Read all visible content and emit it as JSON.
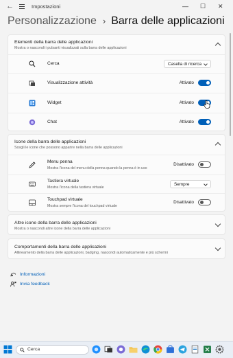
{
  "window": {
    "title": "Impostazioni",
    "back_glyph": "←",
    "min_glyph": "—",
    "max_glyph": "☐",
    "close_glyph": "✕"
  },
  "breadcrumb": {
    "parent": "Personalizzazione",
    "separator": "›",
    "current": "Barra delle applicazioni"
  },
  "section_taskbar_items": {
    "title": "Elementi della barra delle applicazioni",
    "subtitle": "Mostra o nascondi i pulsanti visualizzati sulla barra delle applicazioni",
    "items": [
      {
        "label": "Cerca",
        "control": "dropdown",
        "value": "Casella di ricerca",
        "icon": "search-icon"
      },
      {
        "label": "Visualizzazione attività",
        "control": "toggle",
        "state": "Attivato",
        "on": true,
        "icon": "task-view-icon"
      },
      {
        "label": "Widget",
        "control": "toggle",
        "state": "Attivato",
        "on": true,
        "icon": "widgets-icon"
      },
      {
        "label": "Chat",
        "control": "toggle",
        "state": "Attivato",
        "on": true,
        "icon": "chat-icon"
      }
    ]
  },
  "section_corner_icons": {
    "title": "Icone della barra delle applicazioni",
    "subtitle": "Scegli le icone che possono apparire nella barra delle applicazioni",
    "items": [
      {
        "label": "Menu penna",
        "sub": "Mostra l'icona del menu della penna quando la penna è in uso",
        "control": "toggle",
        "state": "Disattivato",
        "on": false,
        "icon": "pen-icon"
      },
      {
        "label": "Tastiera virtuale",
        "sub": "Mostra l'icona della tastiera virtuale",
        "control": "dropdown",
        "value": "Sempre",
        "icon": "keyboard-icon"
      },
      {
        "label": "Touchpad virtuale",
        "sub": "Mostra sempre l'icona del touchpad virtuale",
        "control": "toggle",
        "state": "Disattivato",
        "on": false,
        "icon": "touchpad-icon"
      }
    ]
  },
  "section_overflow": {
    "title": "Altre icone della barra delle applicazioni",
    "subtitle": "Mostra o nascondi altre icone della barra delle applicazioni"
  },
  "section_behaviors": {
    "title": "Comportamenti della barra delle applicazioni",
    "subtitle": "Allineamento della barra delle applicazioni, badging, nascondi automaticamente e più schermi"
  },
  "links": {
    "info": "Informazioni",
    "feedback": "Invia feedback"
  },
  "taskbar": {
    "search_placeholder": "Cerca"
  },
  "colors": {
    "accent": "#005fb8",
    "background": "#f3f3f3",
    "card": "#fbfbfb"
  }
}
